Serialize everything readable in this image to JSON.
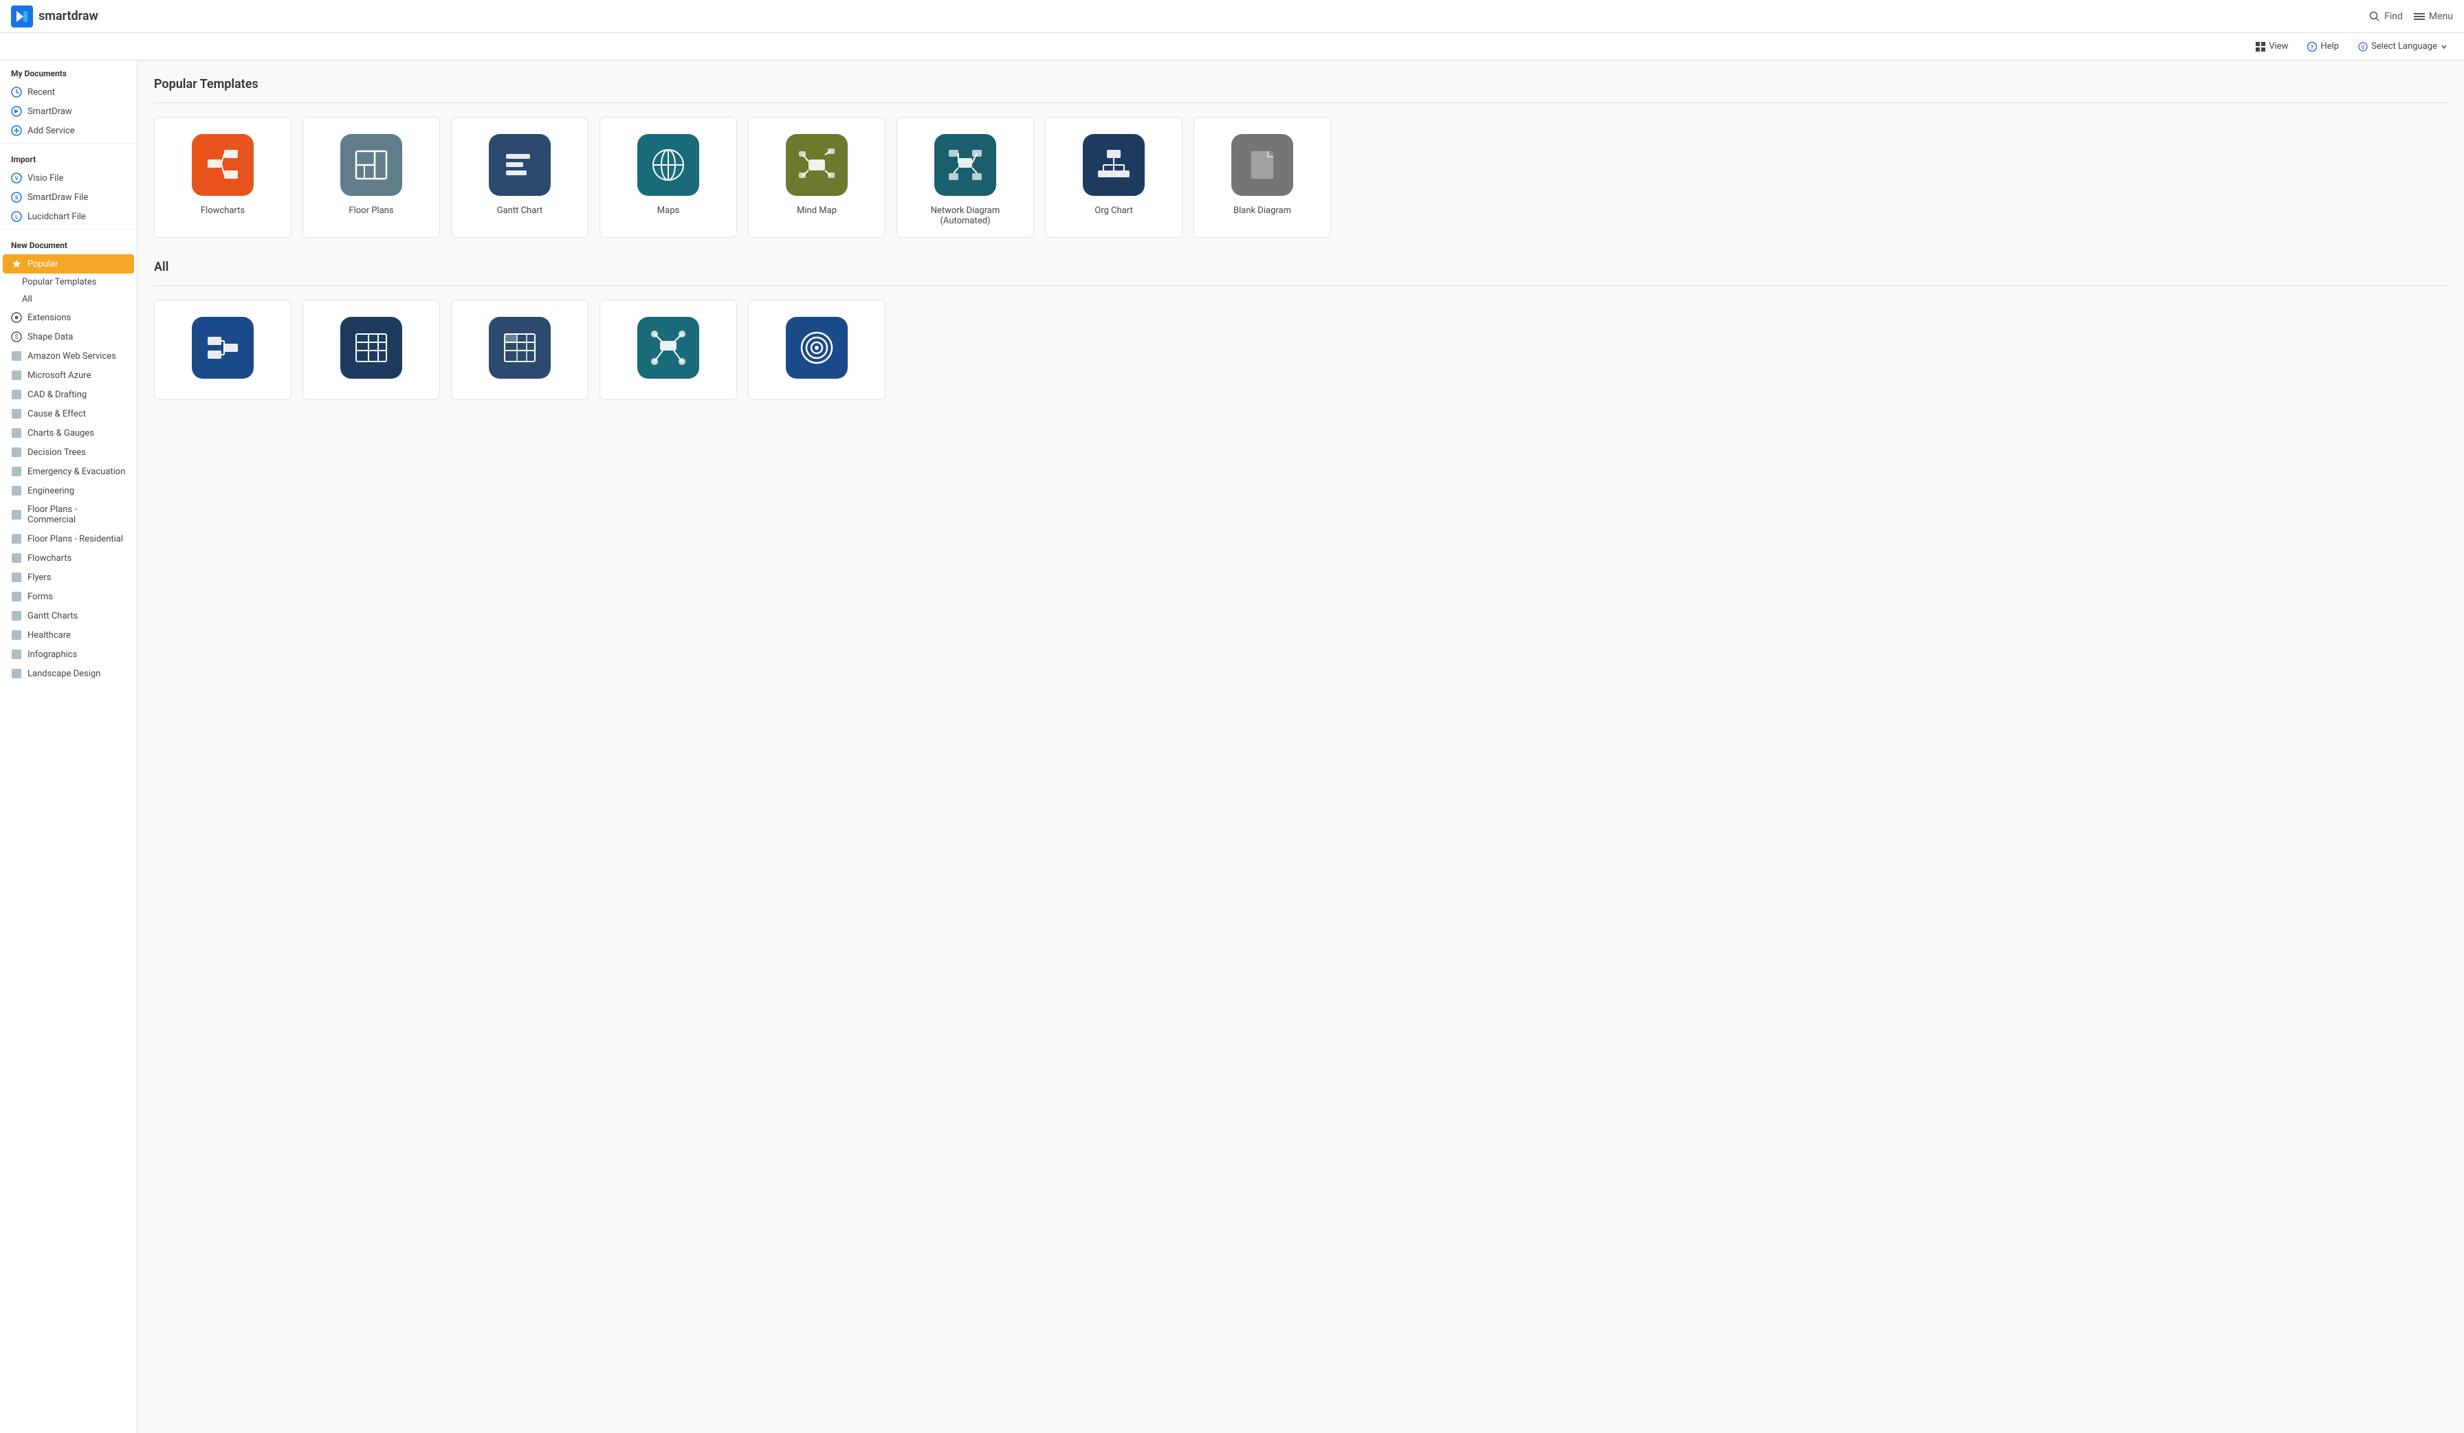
{
  "app": {
    "name": "smartdraw",
    "logo_text": "smartdraw"
  },
  "header": {
    "search_label": "Find",
    "menu_label": "Menu",
    "view_label": "View",
    "help_label": "Help",
    "language_label": "Select Language"
  },
  "sidebar": {
    "my_documents_label": "My Documents",
    "recent_label": "Recent",
    "smartdraw_label": "SmartDraw",
    "add_service_label": "Add Service",
    "import_label": "Import",
    "visio_file_label": "Visio File",
    "smartdraw_file_label": "SmartDraw File",
    "lucidchart_file_label": "Lucidchart File",
    "new_document_label": "New Document",
    "popular_label": "Popular",
    "popular_templates_label": "Popular Templates",
    "all_label": "All",
    "extensions_label": "Extensions",
    "shape_data_label": "Shape Data",
    "items": [
      "Amazon Web Services",
      "Microsoft Azure",
      "CAD & Drafting",
      "Cause & Effect",
      "Charts & Gauges",
      "Decision Trees",
      "Emergency & Evacuation",
      "Engineering",
      "Floor Plans - Commercial",
      "Floor Plans - Residential",
      "Flowcharts",
      "Flyers",
      "Forms",
      "Gantt Charts",
      "Healthcare",
      "Infographics",
      "Landscape Design"
    ]
  },
  "popular_templates": {
    "section_title": "Popular Templates",
    "cards": [
      {
        "label": "Flowcharts",
        "icon_color": "orange"
      },
      {
        "label": "Floor Plans",
        "icon_color": "gray-blue"
      },
      {
        "label": "Gantt Chart",
        "icon_color": "dark-blue"
      },
      {
        "label": "Maps",
        "icon_color": "teal"
      },
      {
        "label": "Mind Map",
        "icon_color": "olive"
      },
      {
        "label": "Network Diagram (Automated)",
        "icon_color": "teal2"
      },
      {
        "label": "Org Chart",
        "icon_color": "navy"
      },
      {
        "label": "Blank Diagram",
        "icon_color": "med-gray"
      }
    ]
  },
  "all_templates": {
    "section_title": "All",
    "cards": [
      {
        "label": "",
        "icon_color": "blue2"
      },
      {
        "label": "",
        "icon_color": "navy"
      },
      {
        "label": "",
        "icon_color": "dark-blue"
      },
      {
        "label": "",
        "icon_color": "teal"
      },
      {
        "label": "",
        "icon_color": "blue2"
      }
    ]
  }
}
